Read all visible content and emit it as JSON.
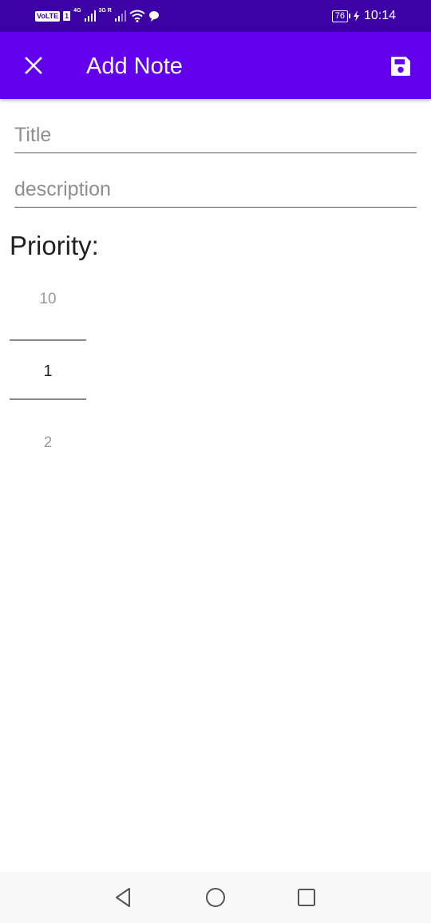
{
  "status_bar": {
    "volte": "VoLTE",
    "sim1": "1",
    "net1": "4G",
    "net2": "3G R",
    "battery": "76",
    "time": "10:14"
  },
  "app_bar": {
    "title": "Add Note",
    "close_icon": "close-icon",
    "save_icon": "floppy-disk-save-icon"
  },
  "form": {
    "title_placeholder": "Title",
    "title_value": "",
    "description_placeholder": "description",
    "description_value": ""
  },
  "priority": {
    "label": "Priority:",
    "previous": "10",
    "selected": "1",
    "next": "2"
  },
  "nav_bar": {
    "back_icon": "triangle-back-icon",
    "home_icon": "circle-home-icon",
    "recents_icon": "square-recents-icon"
  },
  "colors": {
    "status_bar": "#3d02a6",
    "app_bar": "#6200ee",
    "on_primary": "#ffffff"
  }
}
